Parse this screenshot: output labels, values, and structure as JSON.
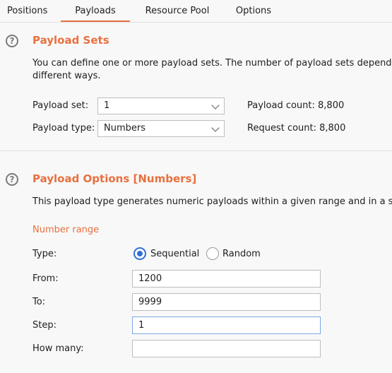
{
  "tabs": [
    {
      "label": "Positions"
    },
    {
      "label": "Payloads"
    },
    {
      "label": "Resource Pool"
    },
    {
      "label": "Options"
    }
  ],
  "active_tab": "Payloads",
  "payload_sets": {
    "title": "Payload Sets",
    "description_line1": "You can define one or more payload sets. The number of payload sets depends",
    "description_line2": "different ways.",
    "payload_set_label": "Payload set:",
    "payload_set_value": "1",
    "payload_type_label": "Payload type:",
    "payload_type_value": "Numbers",
    "payload_count": "Payload count: 8,800",
    "request_count": "Request count: 8,800"
  },
  "payload_options": {
    "title": "Payload Options [Numbers]",
    "description": "This payload type generates numeric payloads within a given range and in a sp",
    "number_range_heading": "Number range",
    "type_label": "Type:",
    "radio_sequential": "Sequential",
    "radio_random": "Random",
    "selected_type": "Sequential",
    "from_label": "From:",
    "from_value": "1200",
    "to_label": "To:",
    "to_value": "9999",
    "step_label": "Step:",
    "step_value": "1",
    "how_many_label": "How many:",
    "how_many_value": ""
  },
  "colors": {
    "accent": "#e8703f",
    "radio_selected": "#2f6fd8",
    "background": "#f8f8f8"
  },
  "icons": {
    "help": "question-circle-icon",
    "dropdown": "chevron-down-icon"
  }
}
